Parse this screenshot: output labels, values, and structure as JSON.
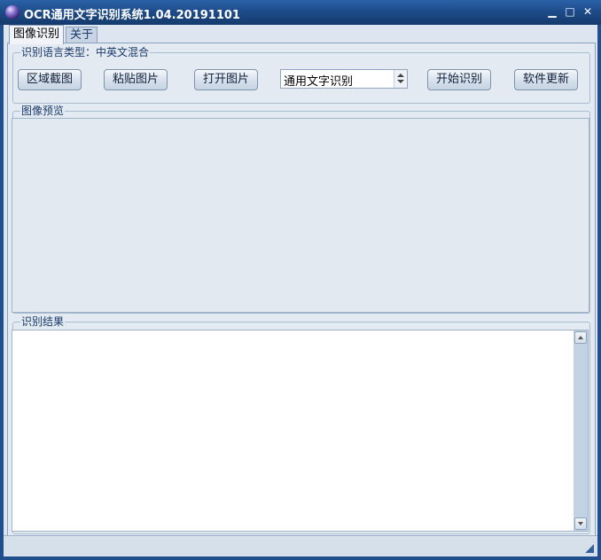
{
  "window": {
    "title": "OCR通用文字识别系统1.04.20191101",
    "controls": {
      "minimize": "▁",
      "maximize": "□",
      "close": "✕"
    }
  },
  "tabs": [
    {
      "label": "图像识别",
      "active": true
    },
    {
      "label": "关于",
      "active": false
    }
  ],
  "language_group": {
    "legend": "识别语言类型：中英文混合",
    "buttons": {
      "region_capture": "区域截图",
      "paste_image": "粘贴图片",
      "open_image": "打开图片",
      "start_recognition": "开始识别",
      "software_update": "软件更新"
    },
    "mode_select": {
      "value": "通用文字识别"
    }
  },
  "preview_group": {
    "legend": "图像预览"
  },
  "result_group": {
    "legend": "识别结果",
    "text": ""
  },
  "colors": {
    "titlebar": "#1d4a86",
    "client_bg": "#dde6f0",
    "accent": "#34609a"
  }
}
